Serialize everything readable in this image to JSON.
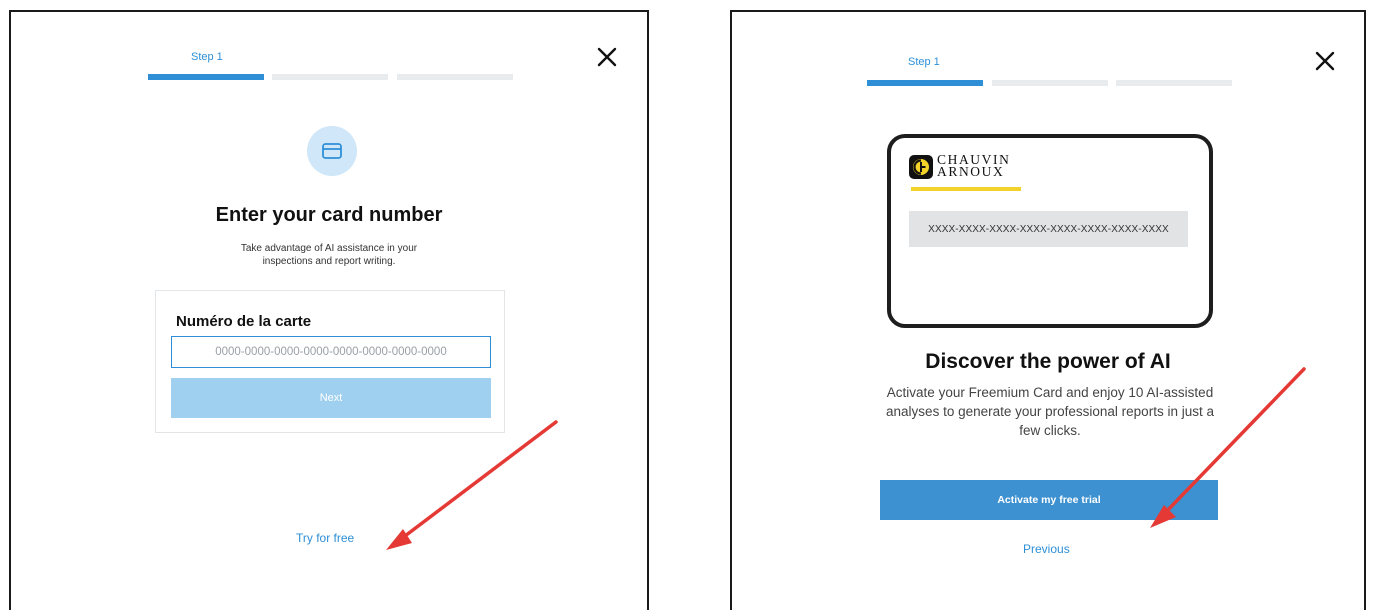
{
  "left_panel": {
    "step_label": "Step 1",
    "close_icon": "close-icon",
    "header_icon": "credit-card-icon",
    "title": "Enter your card number",
    "subtitle_line1": "Take advantage of AI assistance in your",
    "subtitle_line2": "inspections and report writing.",
    "field_label": "Numéro de la carte",
    "card_input_placeholder": "0000-0000-0000-0000-0000-0000-0000-0000",
    "card_input_value": "",
    "next_button_label": "Next",
    "try_free_link": "Try for free"
  },
  "right_panel": {
    "step_label": "Step 1",
    "close_icon": "close-icon",
    "card_brand_line1": "CHAUVIN",
    "card_brand_line2": "ARNOUX",
    "card_number_placeholder": "XXXX-XXXX-XXXX-XXXX-XXXX-XXXX-XXXX-XXXX",
    "title": "Discover the power of AI",
    "description_line1": "Activate your Freemium Card and enjoy 10 AI-assisted",
    "description_line2": "analyses to generate your professional reports in just a",
    "description_line3": "few clicks.",
    "activate_button_label": "Activate my free trial",
    "previous_link": "Previous"
  },
  "colors": {
    "accent": "#2e8fd6",
    "button_disabled": "#9fd0ef",
    "annotation_arrow": "#e53935",
    "brand_yellow": "#f3d32a"
  }
}
